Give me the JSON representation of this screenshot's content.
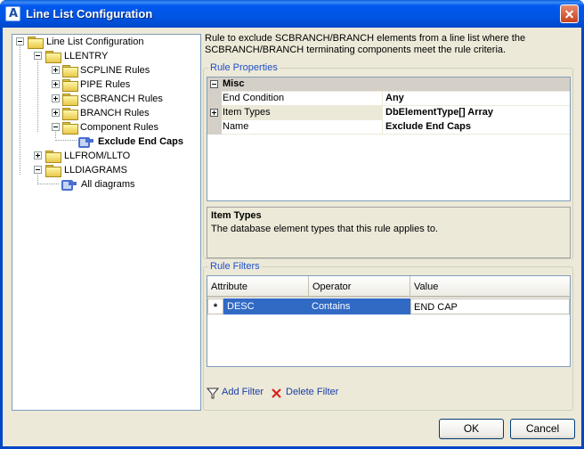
{
  "window": {
    "title": "Line List Configuration"
  },
  "tree": {
    "root": "Line List Configuration",
    "llentry": "LLENTRY",
    "scpline": "SCPLINE Rules",
    "pipe": "PIPE Rules",
    "scbranch": "SCBRANCH Rules",
    "branch": "BRANCH Rules",
    "component": "Component Rules",
    "exclude": "Exclude End Caps",
    "llfrom": "LLFROM/LLTO",
    "lldiagrams": "LLDIAGRAMS",
    "alldiagrams": "All diagrams"
  },
  "description": "Rule to exclude SCBRANCH/BRANCH elements from a line list where the SCBRANCH/BRANCH terminating components meet the rule criteria.",
  "rule_properties": {
    "group_label": "Rule Properties",
    "section": "Misc",
    "rows": [
      {
        "name": "End Condition",
        "value": "Any"
      },
      {
        "name": "Item Types",
        "value": "DbElementType[] Array"
      },
      {
        "name": "Name",
        "value": "Exclude End Caps"
      }
    ],
    "help_title": "Item Types",
    "help_text": "The database element types that this rule applies to."
  },
  "rule_filters": {
    "group_label": "Rule Filters",
    "columns": [
      "Attribute",
      "Operator",
      "Value"
    ],
    "rows": [
      {
        "marker": "*",
        "attribute": "DESC",
        "operator": "Contains",
        "value": "END CAP"
      }
    ],
    "add_label": "Add Filter",
    "delete_label": "Delete Filter"
  },
  "buttons": {
    "ok": "OK",
    "cancel": "Cancel"
  },
  "colors": {
    "title_bar": "#0055e5",
    "selection": "#316ac5",
    "group_label": "#1f4ec9",
    "dialog_bg": "#ece9d8"
  }
}
